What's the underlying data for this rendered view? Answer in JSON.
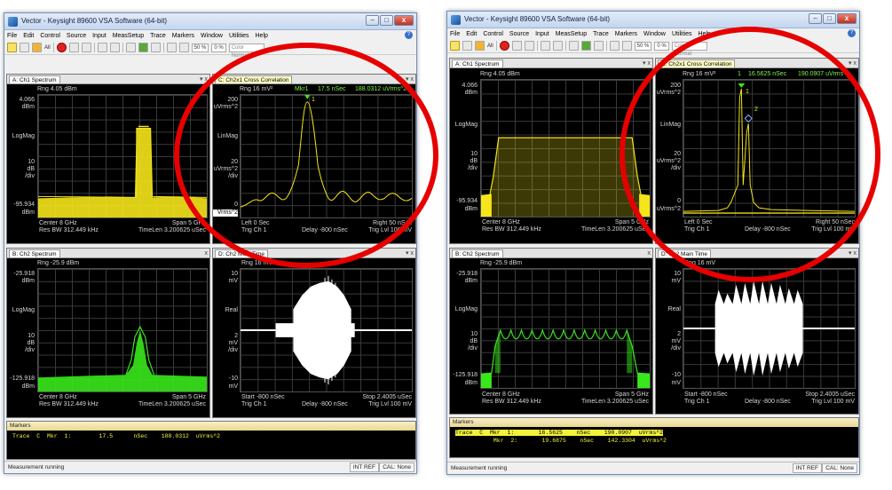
{
  "title": "Vector - Keysight 89600 VSA Software (64-bit)",
  "menu": [
    "File",
    "Edit",
    "Control",
    "Source",
    "Input",
    "MeasSetup",
    "Trace",
    "Markers",
    "Window",
    "Utilities",
    "Help"
  ],
  "toolbar": {
    "all_label": "All",
    "zoom": "50 %",
    "zero": "0 %",
    "color_mode": "Color Normal"
  },
  "left": {
    "panels": {
      "a": {
        "tab": "A: Ch1 Spectrum",
        "rng": "Rng 4.05 dBm",
        "top_val": "4.066",
        "top_unit": "dBm",
        "scale_type": "LogMag",
        "div_val": "10",
        "div_unit": "dB",
        "div": "/div",
        "bottom_val": "-95.934",
        "bottom_unit": "dBm",
        "center": "Center 8 GHz",
        "span": "Span 5 GHz",
        "resbw": "Res BW 312.449 kHz",
        "timelen": "TimeLen 3.200625 uSec"
      },
      "b": {
        "tab": "B: Ch2 Spectrum",
        "rng": "Rng -25.9 dBm",
        "top_val": "-25.918",
        "top_unit": "dBm",
        "scale_type": "LogMag",
        "div_val": "10",
        "div_unit": "dB",
        "div": "/div",
        "bottom_val": "-125.918",
        "bottom_unit": "dBm",
        "center": "Center 8 GHz",
        "span": "Span 5 GHz",
        "resbw": "Res BW 312.449 kHz",
        "timelen": "TimeLen 3.200625 uSec"
      },
      "c": {
        "tab": "C: Ch2x1 Cross Correlation",
        "rng": "Rng 16 mV²",
        "mkr_label": "Mkr1",
        "mkr_time": "17.5 nSec",
        "mkr_value": "188.0312 uVrms^2",
        "top_val": "200",
        "top_unit": "uVrms^2",
        "scale_type": "LinMag",
        "div_val": "20",
        "div_unit": "uVrms^2",
        "div": "/div",
        "bottom_val": "0",
        "bottom_unit": "Vrms^2",
        "left": "Left 0 Sec",
        "right": "Right 50 nSec",
        "trig": "Trig Ch 1",
        "delay": "Delay -800 nSec",
        "triglvl": "Trig Lvl 100 mV",
        "marker_num": "1"
      },
      "d": {
        "tab": "D: Ch2 Main Time",
        "rng": "Rng 16 mV",
        "top_val": "10",
        "top_unit": "mV",
        "scale_type": "Real",
        "div_val": "2",
        "div_unit": "mV",
        "div": "/div",
        "bottom_val": "-10",
        "bottom_unit": "mV",
        "start": "Start -800 nSec",
        "stop": "Stop 2.4005 uSec",
        "trig": "Trig Ch 1",
        "delay": "Delay -800 nSec",
        "triglvl": "Trig Lvl 100 mV"
      }
    },
    "markers": {
      "tab": "Markers",
      "rows": [
        "Trace  C  Mkr  1:        17.5      nSec    188.0312  uVrms^2"
      ]
    },
    "status": {
      "text": "Measurement running",
      "intref": "INT REF",
      "cal": "CAL: None"
    }
  },
  "right": {
    "panels": {
      "a": {
        "tab": "A: Ch1 Spectrum",
        "rng": "Rng 4.05 dBm",
        "top_val": "4.066",
        "top_unit": "dBm",
        "scale_type": "LogMag",
        "div_val": "10",
        "div_unit": "dB",
        "div": "/div",
        "bottom_val": "-95.934",
        "bottom_unit": "dBm",
        "center": "Center 8 GHz",
        "span": "Span 5 GHz",
        "resbw": "Res BW 312.449 kHz",
        "timelen": "TimeLen 3.200625 uSec"
      },
      "b": {
        "tab": "B: Ch2 Spectrum",
        "rng": "Rng -25.9 dBm",
        "top_val": "-25.918",
        "top_unit": "dBm",
        "scale_type": "LogMag",
        "div_val": "10",
        "div_unit": "dB",
        "div": "/div",
        "bottom_val": "-125.918",
        "bottom_unit": "dBm",
        "center": "Center 8 GHz",
        "span": "Span 5 GHz",
        "resbw": "Res BW 312.449 kHz",
        "timelen": "TimeLen 3.200625 uSec"
      },
      "c": {
        "tab": "C: Ch2x1 Cross Correlation",
        "rng": "Rng 16 mV²",
        "mkr_label": "1",
        "mkr_time": "16.5625 nSec",
        "mkr_value": "190.0907 uVrms^2",
        "top_val": "200",
        "top_unit": "uVrms^2",
        "scale_type": "LinMag",
        "div_val": "20",
        "div_unit": "uVrms^2",
        "div": "/div",
        "bottom_val": "0",
        "bottom_unit": "uVrms^2",
        "left": "Left 0 Sec",
        "right": "Right 50 nSec",
        "trig": "Trig Ch 1",
        "delay": "Delay -800 nSec",
        "triglvl": "Trig Lvl 100 mV",
        "marker_num": "1",
        "marker_num2": "2"
      },
      "d": {
        "tab": "D: Ch2 Main Time",
        "rng": "Rng 16 mV",
        "top_val": "10",
        "top_unit": "mV",
        "scale_type": "Real",
        "div_val": "2",
        "div_unit": "mV",
        "div": "/div",
        "bottom_val": "-10",
        "bottom_unit": "mV",
        "start": "Start -800 nSec",
        "stop": "Stop 2.4005 uSec",
        "trig": "Trig Ch 1",
        "delay": "Delay -800 nSec",
        "triglvl": "Trig Lvl 100 mV"
      }
    },
    "markers": {
      "tab": "Markers",
      "rows": [
        "Trace  C  Mkr  1:       16.5625    nSec    190.0907  uVrms^2",
        "           Mkr  2:       19.6875    nSec    142.3304  uVrms^2"
      ]
    },
    "status": {
      "text": "Measurement running",
      "intref": "INT REF",
      "cal": "CAL: None"
    }
  },
  "colors": {
    "ch1": "#f5e51a",
    "ch2": "#38e81a",
    "time": "#ffffff",
    "highlight": "#e60000"
  }
}
